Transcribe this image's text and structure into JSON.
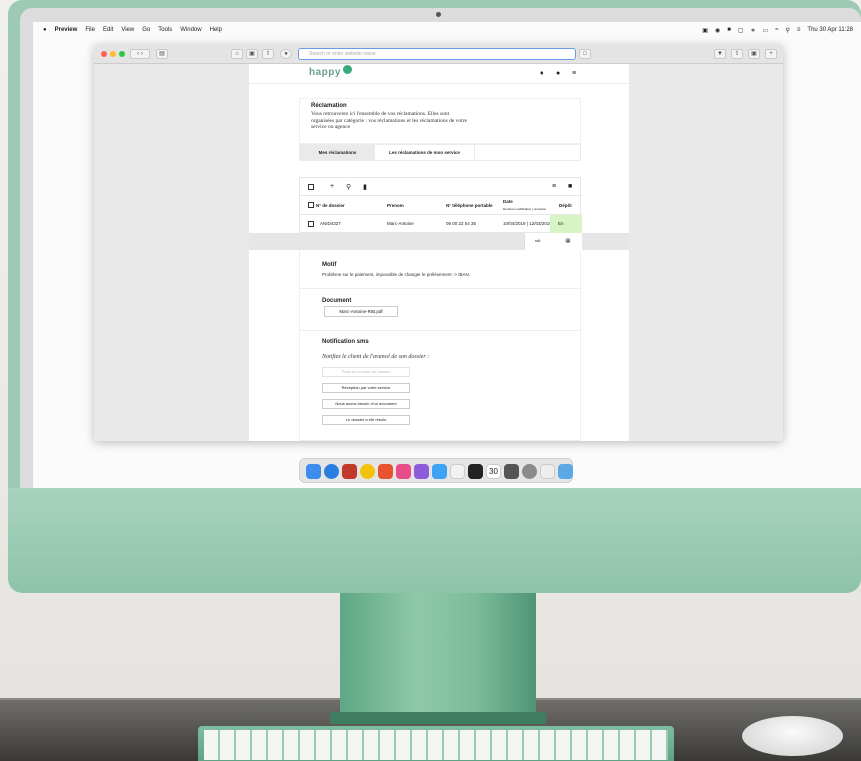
{
  "menubar": {
    "apple": "",
    "app": "Preview",
    "items": [
      "File",
      "Edit",
      "View",
      "Go",
      "Tools",
      "Window",
      "Help"
    ],
    "clock": "Thu 30 Apr  11:28"
  },
  "browser": {
    "url_placeholder": "Search or enter website name"
  },
  "site": {
    "logo": "happy",
    "intro_title": "Réclamation",
    "intro_text": "Vous retrouverez ici l'ensemble de vos réclamations. Elles sont organisées par catégorie : vos réclamations et les réclamations de votre service ou agence",
    "tabs": [
      "Mes réclamations",
      "Les réclamations de mon service"
    ]
  },
  "grid": {
    "columns": {
      "dossier": "N° de dossier",
      "prenom": "Prenom",
      "tel": "N° téléphone portable",
      "date": "Date",
      "date_sub": "Dernière modification | réception",
      "depot": "Dépôt"
    },
    "row": {
      "dossier": "ANID4327",
      "prenom": "Marc-Antoine",
      "tel": "06 00 22 54 35",
      "date": "10/04/2019 | 12/03/2019",
      "depot": "En"
    }
  },
  "detail": {
    "motif_title": "Motif",
    "motif_text": "Problème sur le paiement, impossible de changer le prélèvement -> IBAN.",
    "document_title": "Document",
    "document_file": "Marc-Antoine-RIB.pdf",
    "sms_title": "Notification sms",
    "sms_subtitle": "Notifiez le client de l'avancé de son dossier :",
    "sms_buttons": [
      {
        "label": "Prise en compte du dossier",
        "disabled": true
      },
      {
        "label": "Réception par votre service",
        "disabled": false
      },
      {
        "label": "Nous avons besoin d'un document",
        "disabled": false
      },
      {
        "label": "Le dossier a été résolu",
        "disabled": false
      }
    ]
  },
  "dock": {
    "calendar_day": "30"
  },
  "colors": {
    "imac_green": "#9ccab4",
    "brand": "#3aa87a",
    "depot_green": "#d7f4c5",
    "url_focus": "#6a9be4"
  }
}
